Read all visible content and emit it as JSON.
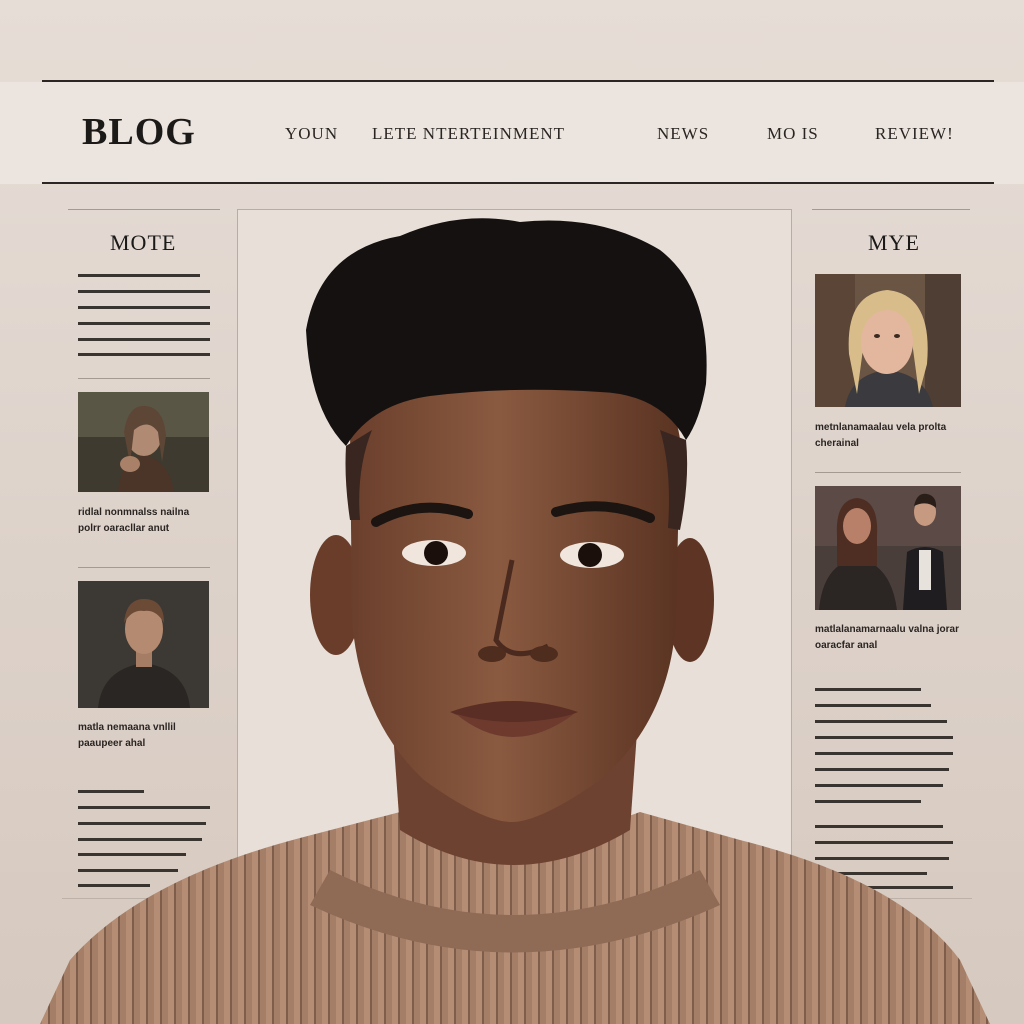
{
  "header": {
    "logo": "BLOG",
    "nav": [
      "YOUN",
      "LETE NTERTEINMENT",
      "NEWS",
      "MO IS",
      "REVIEW!"
    ]
  },
  "left_sidebar": {
    "title": "MOTE",
    "cards": [
      {
        "caption": "ridlal nonmnalss nailna polrr oaracllar anut"
      },
      {
        "caption": "matla nemaana vnllil paaupeer ahal"
      }
    ]
  },
  "right_sidebar": {
    "title": "MYE",
    "cards": [
      {
        "caption": "metnlanamaalau vela prolta cherainal"
      },
      {
        "caption": "matlalanamarnaalu valna jorar oaracfar anal"
      }
    ]
  },
  "colors": {
    "background": "#e3d9d1",
    "header_bg": "#ece5df",
    "text": "#1b1a19",
    "rule": "#2b2624",
    "sweater": "#a47e67",
    "skin": "#7a4b34"
  },
  "icons": {
    "hero": "portrait-photo",
    "thumbs": [
      "person-photo",
      "person-photo",
      "girl-photo",
      "couple-photo"
    ]
  }
}
